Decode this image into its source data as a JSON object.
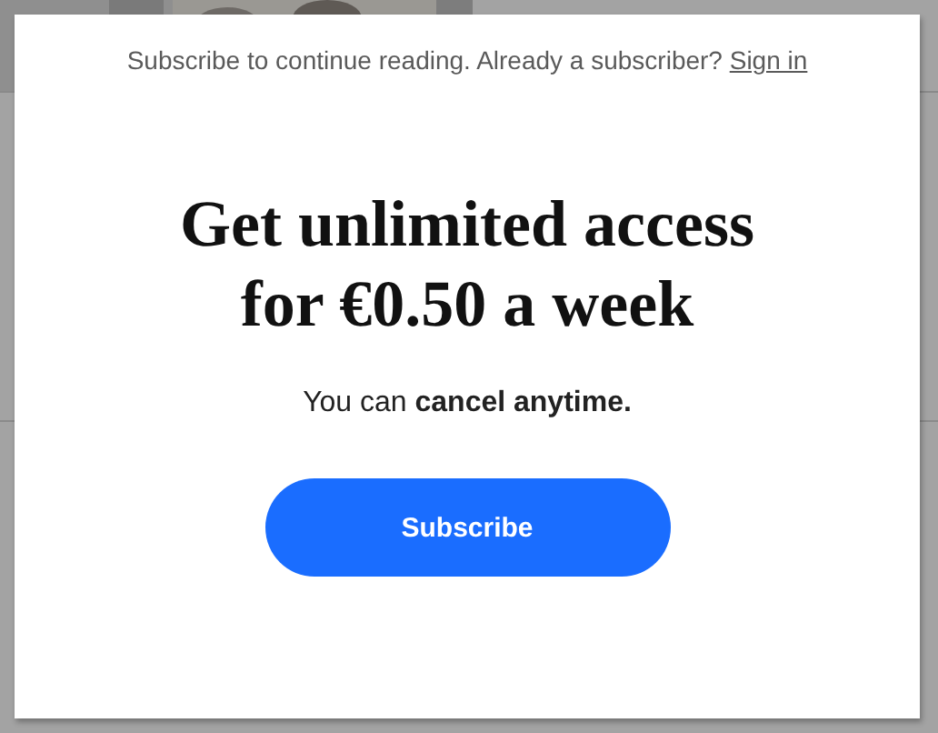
{
  "modal": {
    "prompt": "Subscribe to continue reading. Already a subscriber?",
    "sign_in_link": "Sign in",
    "heading": "Get unlimited access for €0.50 a week",
    "note": "You can **cancel anytime.**",
    "button": "Subscribe"
  }
}
